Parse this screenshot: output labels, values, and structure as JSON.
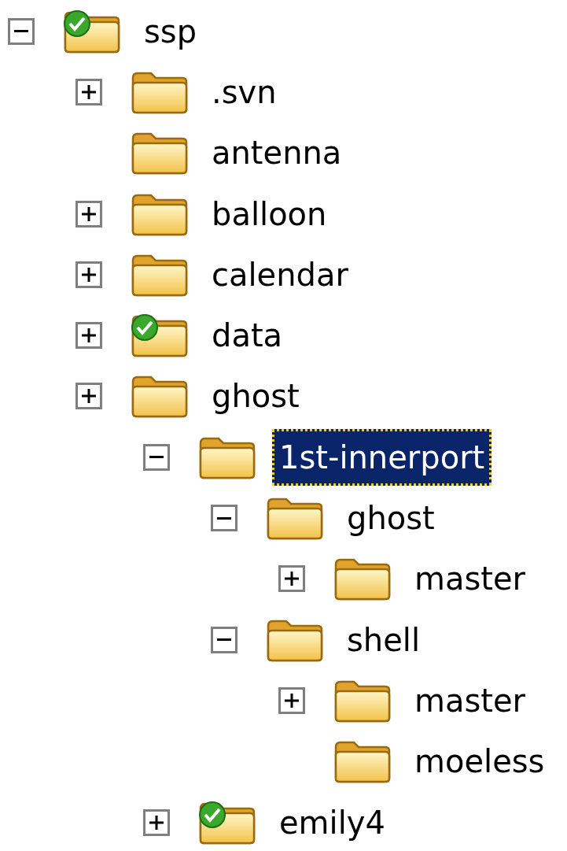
{
  "tree": [
    {
      "label": "ssp",
      "expanded": true,
      "synced": true,
      "selected": false,
      "children": [
        {
          "label": ".svn",
          "expanded": false,
          "synced": false,
          "selected": false
        },
        {
          "label": "antenna",
          "synced": false,
          "selected": false
        },
        {
          "label": "balloon",
          "expanded": false,
          "synced": false,
          "selected": false
        },
        {
          "label": "calendar",
          "expanded": false,
          "synced": false,
          "selected": false
        },
        {
          "label": "data",
          "expanded": false,
          "synced": true,
          "selected": false
        },
        {
          "label": "ghost",
          "expanded": false,
          "synced": false,
          "selected": false,
          "children": [
            {
              "label": "1st-innerport",
              "expanded": true,
              "synced": false,
              "selected": true,
              "children": [
                {
                  "label": "ghost",
                  "expanded": true,
                  "synced": false,
                  "selected": false,
                  "children": [
                    {
                      "label": "master",
                      "expanded": false,
                      "synced": false,
                      "selected": false
                    }
                  ]
                },
                {
                  "label": "shell",
                  "expanded": true,
                  "synced": false,
                  "selected": false,
                  "children": [
                    {
                      "label": "master",
                      "expanded": false,
                      "synced": false,
                      "selected": false
                    },
                    {
                      "label": "moeless",
                      "synced": false,
                      "selected": false
                    }
                  ]
                }
              ]
            },
            {
              "label": "emily4",
              "expanded": false,
              "synced": true,
              "selected": false
            }
          ]
        }
      ]
    }
  ]
}
